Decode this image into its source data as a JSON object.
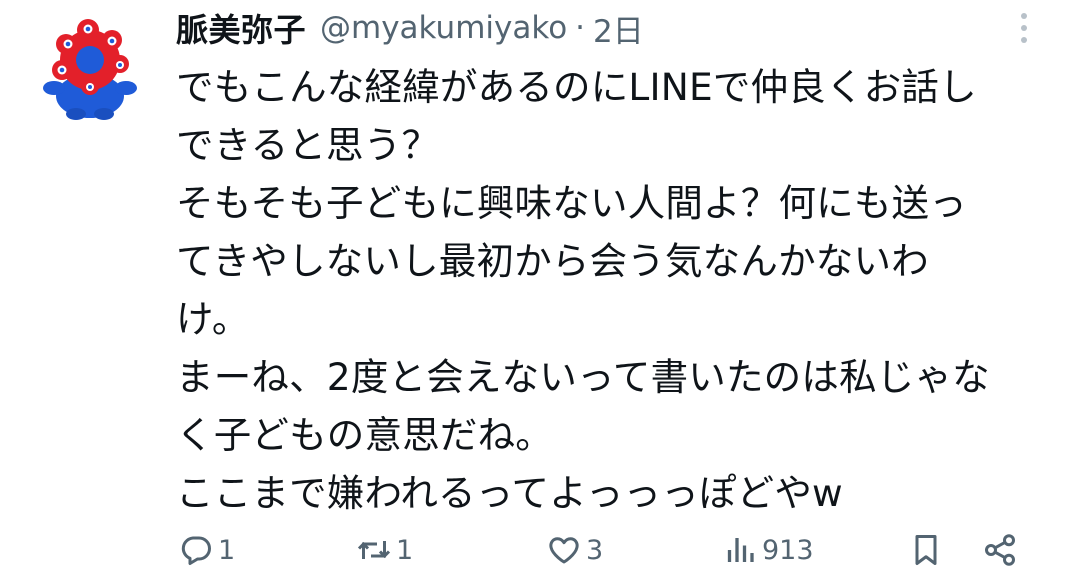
{
  "author": {
    "display_name": "脈美弥子",
    "handle": "@myakumiyako",
    "separator": "·",
    "time": "2日"
  },
  "body_lines": [
    "でもこんな経緯があるのにLINEで仲良くお話し",
    "できると思う？",
    "そもそも子どもに興味ない人間よ？何にも送っ",
    "てきやしないし最初から会う気なんかないわ",
    "け。",
    "まーね、2度と会えないって書いたのは私じゃな",
    "く子どもの意思だね。",
    "ここまで嫌われるってよっっっぽどやw"
  ],
  "actions": {
    "reply_count": "1",
    "retweet_count": "1",
    "like_count": "3",
    "views_count": "913"
  },
  "icons": {
    "avatar": "mascot-avatar",
    "more": "more-vertical-icon",
    "reply": "reply-icon",
    "retweet": "retweet-icon",
    "like": "heart-icon",
    "views": "views-icon",
    "bookmark": "bookmark-icon",
    "share": "share-icon"
  },
  "colors": {
    "text_primary": "#0f1419",
    "text_secondary": "#536471",
    "mascot_red": "#e3202a",
    "mascot_blue": "#1f5bd8"
  }
}
